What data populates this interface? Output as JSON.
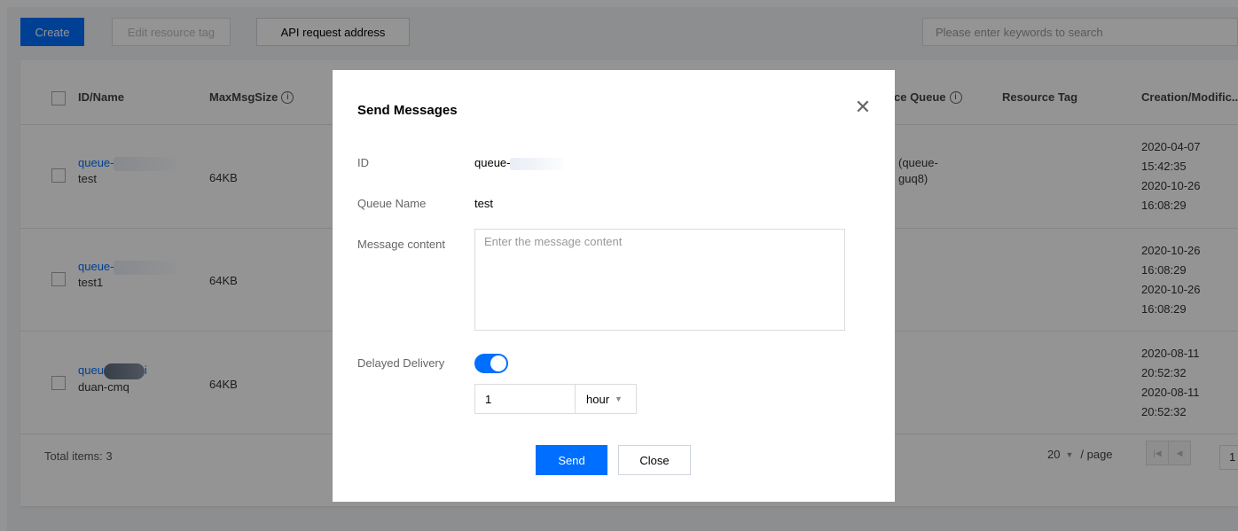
{
  "toolbar": {
    "create_label": "Create",
    "edit_tag_label": "Edit resource tag",
    "api_label": "API request address",
    "search_placeholder": "Please enter keywords to search"
  },
  "table": {
    "columns": {
      "id_name": "ID/Name",
      "max_msg_size": "MaxMsgSize",
      "source_queue": "ce Queue",
      "resource_tag": "Resource Tag",
      "creation": "Creation/Modific..."
    },
    "rows": [
      {
        "id": "queue-",
        "name": "test",
        "max_msg_size": "64KB",
        "source_queue": [
          "(queue-",
          "guq8)"
        ],
        "created_date": "2020-04-07",
        "created_time": "15:42:35",
        "modified_date": "2020-10-26",
        "modified_time": "16:08:29"
      },
      {
        "id": "queue-",
        "name": "test1",
        "max_msg_size": "64KB",
        "source_queue": [
          "",
          ""
        ],
        "created_date": "2020-10-26",
        "created_time": "16:08:29",
        "modified_date": "2020-10-26",
        "modified_time": "16:08:29"
      },
      {
        "id": "queu",
        "id_suffix": "i",
        "name": "duan-cmq",
        "max_msg_size": "64KB",
        "source_queue": [
          "",
          ""
        ],
        "created_date": "2020-08-11",
        "created_time": "20:52:32",
        "modified_date": "2020-08-11",
        "modified_time": "20:52:32"
      }
    ],
    "total": "Total items: 3",
    "page_size": "20",
    "per_page": "/ page",
    "page_number": "1"
  },
  "modal": {
    "title": "Send Messages",
    "id_label": "ID",
    "id_value": "queue-",
    "queue_name_label": "Queue Name",
    "queue_name_value": "test",
    "message_label": "Message content",
    "message_placeholder": "Enter the message content",
    "delay_label": "Delayed Delivery",
    "delay_enabled": true,
    "delay_value": "1",
    "delay_unit": "hour",
    "send_label": "Send",
    "close_label": "Close"
  },
  "colors": {
    "accent": "#006eff",
    "overlay": "rgba(0,0,0,0.42)"
  }
}
